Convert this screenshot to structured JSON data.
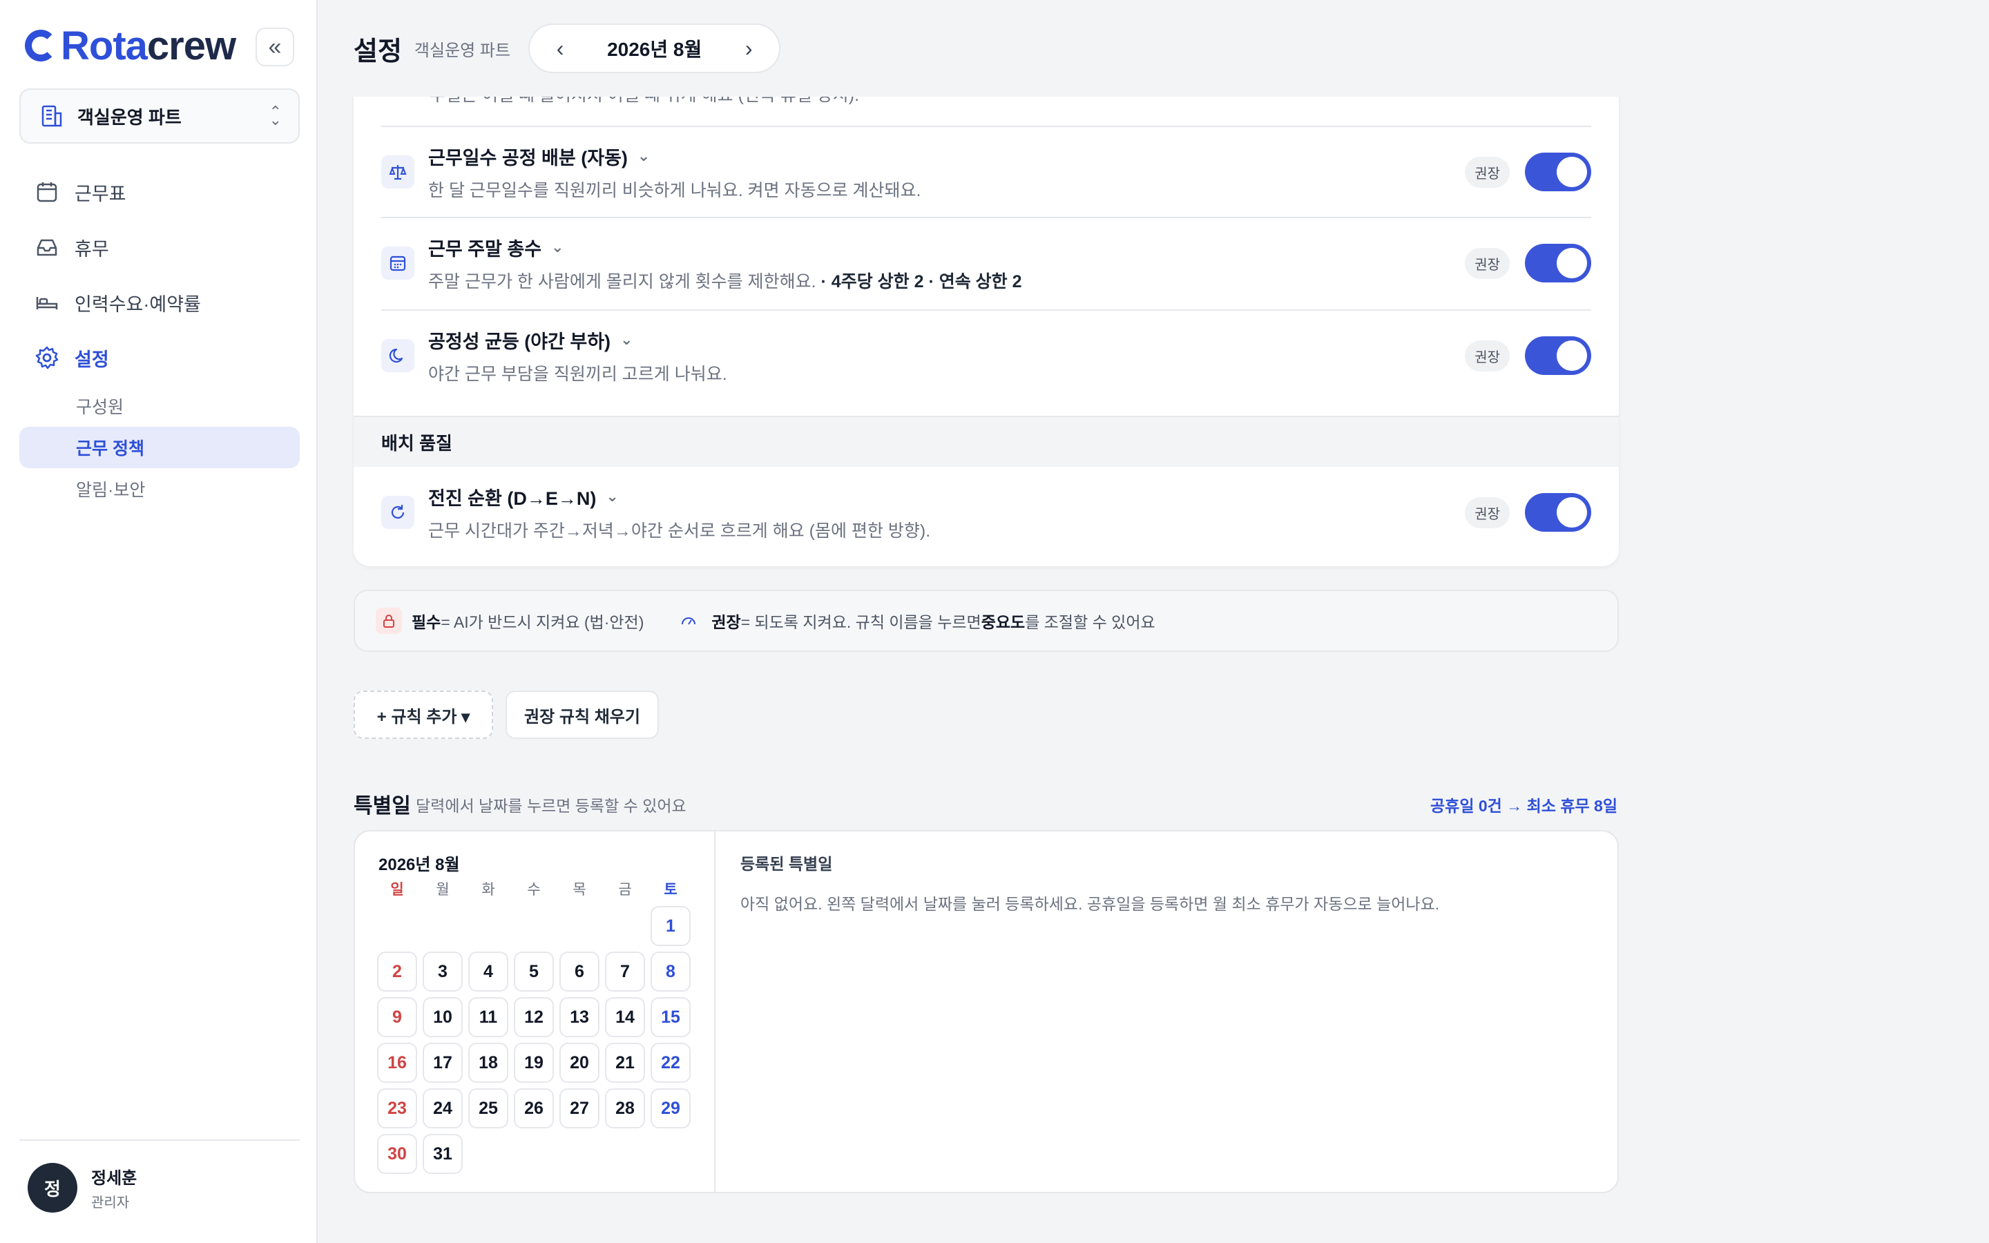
{
  "brand": {
    "rota": "Rota",
    "crew": "crew"
  },
  "team_select": {
    "label": "객실운영 파트"
  },
  "nav": {
    "items": [
      {
        "label": "근무표",
        "icon": "calendar-icon"
      },
      {
        "label": "휴무",
        "icon": "inbox-icon"
      },
      {
        "label": "인력수요·예약률",
        "icon": "bed-icon"
      },
      {
        "label": "설정",
        "icon": "gear-icon"
      }
    ],
    "sub_items": [
      {
        "label": "구성원"
      },
      {
        "label": "근무 정책"
      },
      {
        "label": "알림·보안"
      }
    ]
  },
  "user": {
    "initial": "정",
    "name": "정세훈",
    "role": "관리자"
  },
  "header": {
    "title": "설정",
    "subtitle": "객실운영 파트",
    "month": "2026년 8월"
  },
  "rules": {
    "clipped_desc": "무일은 어떨 때 줄어지지 어떨 때 쉬게 해요 (연속 휴일 방지).",
    "items": [
      {
        "title": "근무일수 공정 배분 (자동)",
        "desc": "한 달 근무일수를 직원끼리 비슷하게 나눠요. 켜면 자동으로 계산돼요.",
        "desc_bold": "",
        "badge": "권장",
        "enabled": true
      },
      {
        "title": "근무 주말 총수",
        "desc": "주말 근무가 한 사람에게 몰리지 않게 횟수를 제한해요.",
        "desc_bold": " · 4주당 상한 2 · 연속 상한 2",
        "badge": "권장",
        "enabled": true
      },
      {
        "title": "공정성 균등 (야간 부하)",
        "desc": "야간 근무 부담을 직원끼리 고르게 나눠요.",
        "desc_bold": "",
        "badge": "권장",
        "enabled": true
      }
    ],
    "section_label": "배치 품질",
    "quality_items": [
      {
        "title": "전진 순환 (D→E→N)",
        "desc": "근무 시간대가 주간→저녁→야간 순서로 흐르게 해요 (몸에 편한 방향).",
        "badge": "권장",
        "enabled": true
      }
    ]
  },
  "legend": {
    "required_label": "필수",
    "required_text": " = AI가 반드시 지켜요 (법·안전)",
    "recommended_label": "권장",
    "recommended_text_1": " = 되도록 지켜요. 규칙 이름을 누르면 ",
    "recommended_bold": "중요도",
    "recommended_text_2": "를 조절할 수 있어요"
  },
  "actions": {
    "add_rule": "+ 규칙 추가 ▾",
    "fill_recommended": "권장 규칙 채우기"
  },
  "special_days": {
    "title": "특별일",
    "hint": "달력에서 날짜를 누르면 등록할 수 있어요",
    "stat": "공휴일 0건 → 최소 휴무 8일",
    "calendar_title": "2026년 8월",
    "weekdays": [
      "일",
      "월",
      "화",
      "수",
      "목",
      "금",
      "토"
    ],
    "leading_blanks": 6,
    "days_in_month": 31,
    "registered_title": "등록된 특별일",
    "registered_empty": "아직 없어요. 왼쪽 달력에서 날짜를 눌러 등록하세요. 공휴일을 등록하면 월 최소 휴무가 자동으로 늘어나요."
  },
  "colors": {
    "accent": "#2e4fd8",
    "toggle_on": "#3b55d9",
    "sunday": "#d14343",
    "saturday": "#2e4fd8"
  }
}
